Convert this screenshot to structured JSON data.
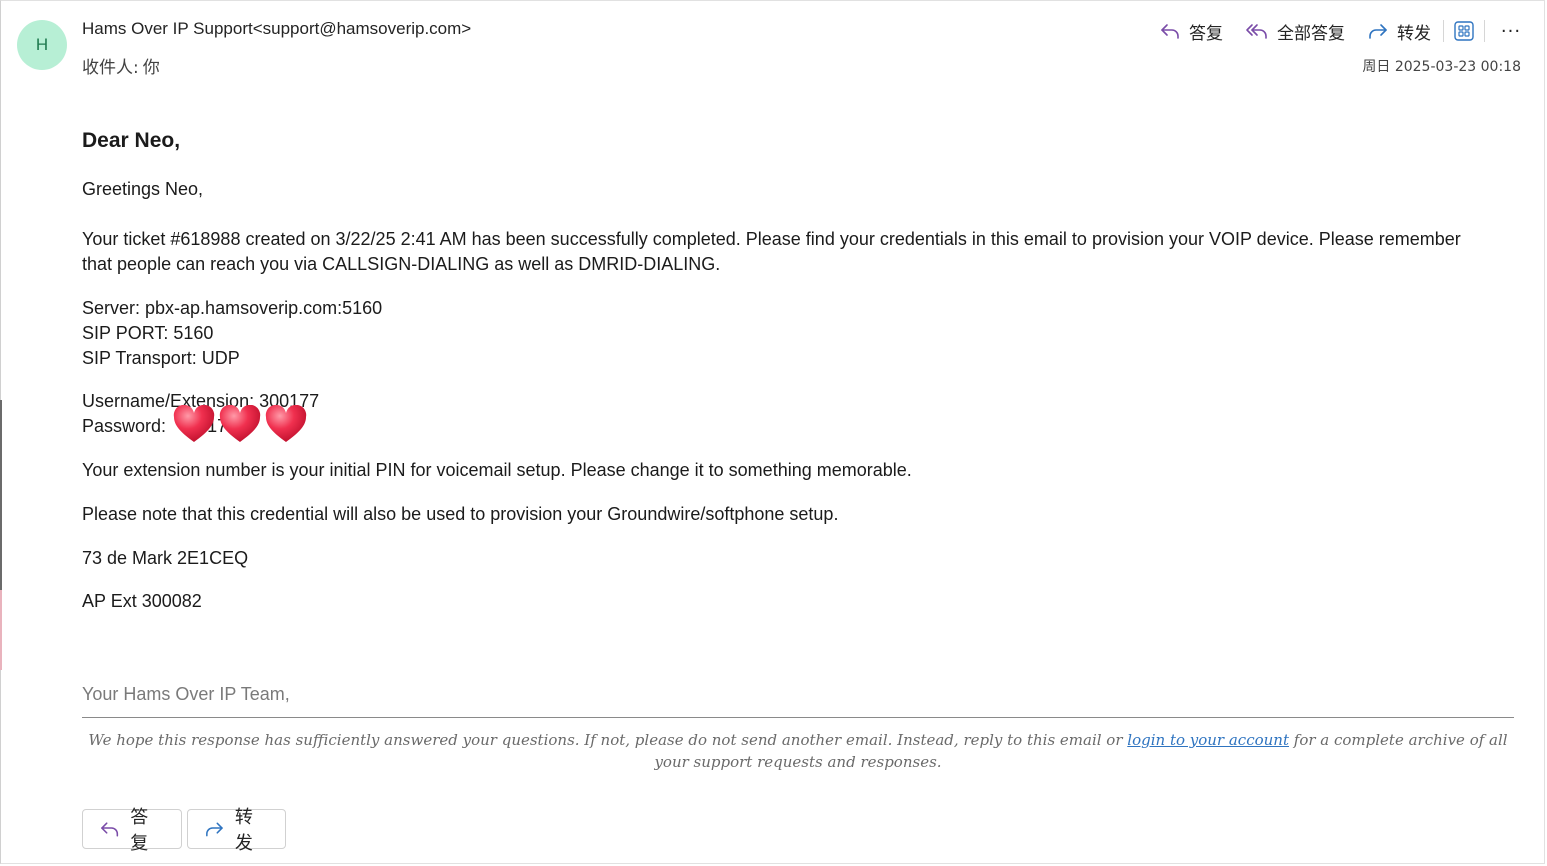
{
  "header": {
    "avatar_initial": "H",
    "sender": "Hams Over IP Support<support@hamsoverip.com>",
    "recipient_label": "收件人:",
    "recipient_value": "你",
    "datetime": "周日 2025-03-23 00:18",
    "actions": {
      "reply": "答复",
      "reply_all": "全部答复",
      "forward": "转发",
      "more": "···"
    }
  },
  "email": {
    "salutation": "Dear Neo,",
    "greeting": "Greetings Neo,",
    "paragraph1_line1": "Your ticket #618988 created on 3/22/25 2:41 AM has been successfully completed. Please find your credentials in this email to provision your VOIP device. Please remember",
    "paragraph1_line2": "that people can reach you via CALLSIGN-DIALING as well as DMRID-DIALING.",
    "server": "Server: pbx-ap.hamsoverip.com:5160",
    "sip_port": "SIP PORT: 5160",
    "sip_transport": "SIP Transport: UDP",
    "username": "Username/Extension: 300177",
    "password_label": "Password:",
    "password_visible": "17  9",
    "pin_note": "Your extension number is your initial PIN for voicemail setup. Please change it to something memorable.",
    "groundwire_note": "Please note that this credential will also be used to provision your Groundwire/softphone setup.",
    "signoff1": "73 de Mark 2E1CEQ",
    "signoff2": "AP Ext 300082",
    "team": "Your Hams Over IP Team,",
    "footnote_before": "We hope this response has sufficiently answered your questions. If not, please do not send another email. Instead, reply to this email or ",
    "footnote_link": "login to your account",
    "footnote_after": " for a complete archive of all your support requests and responses."
  },
  "bottom_buttons": {
    "reply": "答复",
    "forward": "转发"
  },
  "colors": {
    "avatar_bg": "#b7efd5",
    "avatar_text": "#1f7a4f",
    "accent_purple": "#7a4ca8",
    "accent_blue": "#2f74c0",
    "heart": "#f0304f"
  },
  "icons": {
    "reply": "reply-arrow-icon",
    "reply_all": "reply-all-arrow-icon",
    "forward": "forward-arrow-icon",
    "apps": "apps-grid-icon",
    "more": "more-dots-icon",
    "sticker": "heart-sticker-icon"
  }
}
